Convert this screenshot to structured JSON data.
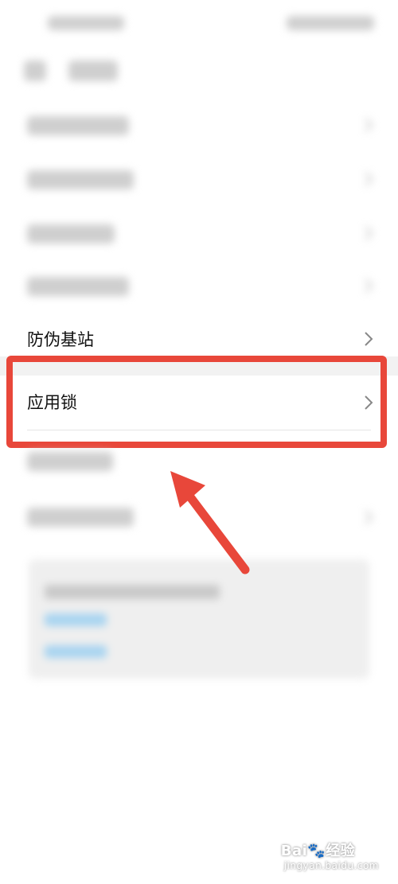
{
  "settings_list": {
    "items": [
      {
        "label": "防伪基站"
      },
      {
        "label": "应用锁"
      }
    ]
  },
  "watermark": {
    "brand": "Bai",
    "suffix": "经验",
    "url": "jingyan.baidu.com"
  },
  "colors": {
    "highlight_frame": "#e8473a",
    "arrow": "#e8473a",
    "link_blue": "#a8d4f0"
  },
  "icons": {
    "chevron": "chevron-right-icon",
    "arrow": "arrow-up-left-annotation"
  }
}
